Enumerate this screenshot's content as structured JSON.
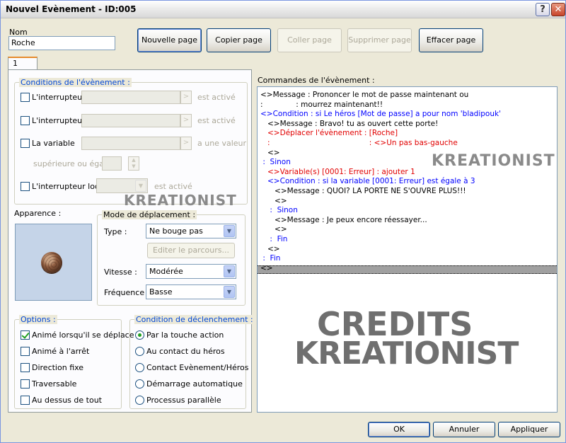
{
  "window": {
    "title": "Nouvel Evènement - ID:005",
    "help": "?",
    "close": "✕"
  },
  "name": {
    "label": "Nom",
    "value": "Roche"
  },
  "page_buttons": {
    "new": "Nouvelle page",
    "copy": "Copier page",
    "paste": "Coller page",
    "delete": "Supprimer page",
    "clear": "Effacer page"
  },
  "tab": {
    "label": "1"
  },
  "conditions": {
    "title": "Conditions de l'évènement :",
    "switch1": "L'interrupteur",
    "switch2": "L'interrupteur",
    "variable": "La variable",
    "activated": "est activé",
    "has_value": "a une valeur",
    "ge": "supérieure ou égale",
    "local_switch": "L'interrupteur local",
    "local_activated": "est activé",
    "browse": ">"
  },
  "appearance": {
    "label": "Apparence :",
    "graphic": "rock-icon"
  },
  "movement": {
    "title": "Mode de déplacement :",
    "type_label": "Type :",
    "type_value": "Ne bouge pas",
    "edit_route": "Editer le parcours...",
    "speed_label": "Vitesse :",
    "speed_value": "Modérée",
    "freq_label": "Fréquence :",
    "freq_value": "Basse"
  },
  "options": {
    "title": "Options :",
    "items": [
      {
        "label": "Animé lorsqu'il se déplace",
        "checked": true
      },
      {
        "label": "Animé à l'arrêt",
        "checked": false
      },
      {
        "label": "Direction fixe",
        "checked": false
      },
      {
        "label": "Traversable",
        "checked": false
      },
      {
        "label": "Au dessus de tout",
        "checked": false
      }
    ]
  },
  "trigger": {
    "title": "Condition de déclenchement :",
    "items": [
      {
        "label": "Par la touche action",
        "selected": true
      },
      {
        "label": "Au contact du héros",
        "selected": false
      },
      {
        "label": "Contact Evènement/Héros",
        "selected": false
      },
      {
        "label": "Démarrage automatique",
        "selected": false
      },
      {
        "label": "Processus parallèle",
        "selected": false
      }
    ]
  },
  "commands": {
    "title": "Commandes de l'évènement :",
    "lines": [
      {
        "text": "<>Message : Prononcer le mot de passe maintenant ou",
        "color": "black"
      },
      {
        "text": ":              : mourrez maintenant!!",
        "color": "black"
      },
      {
        "text": "<>Condition : si Le héros [Mot de passe] a pour nom 'bladipouk'",
        "color": "blue"
      },
      {
        "text": "   <>Message : Bravo! tu as ouvert cette porte!",
        "color": "black"
      },
      {
        "text": "   <>Déplacer l'évènement : [Roche]",
        "color": "red"
      },
      {
        "text": "   :                                          : <>Un pas bas-gauche",
        "color": "red"
      },
      {
        "text": "   <>",
        "color": "black"
      },
      {
        "text": " :  Sinon",
        "color": "blue"
      },
      {
        "text": "   <>Variable(s) [0001: Erreur] : ajouter 1",
        "color": "red"
      },
      {
        "text": "   <>Condition : si la variable [0001: Erreur] est égale à 3",
        "color": "blue"
      },
      {
        "text": "      <>Message : QUOI? LA PORTE NE S'OUVRE PLUS!!!",
        "color": "black"
      },
      {
        "text": "      <>",
        "color": "black"
      },
      {
        "text": "    :  Sinon",
        "color": "blue"
      },
      {
        "text": "      <>Message : Je peux encore réessayer...",
        "color": "black"
      },
      {
        "text": "      <>",
        "color": "black"
      },
      {
        "text": "    :  Fin",
        "color": "blue"
      },
      {
        "text": "   <>",
        "color": "black"
      },
      {
        "text": " :  Fin",
        "color": "blue"
      },
      {
        "text": "<>",
        "color": "black"
      }
    ]
  },
  "watermarks": {
    "small1": "KREATIONIST",
    "small2": "KREATIONIST",
    "big1": "CREDITS",
    "big2": "KREATIONIST"
  },
  "footer": {
    "ok": "OK",
    "cancel": "Annuler",
    "apply": "Appliquer"
  }
}
